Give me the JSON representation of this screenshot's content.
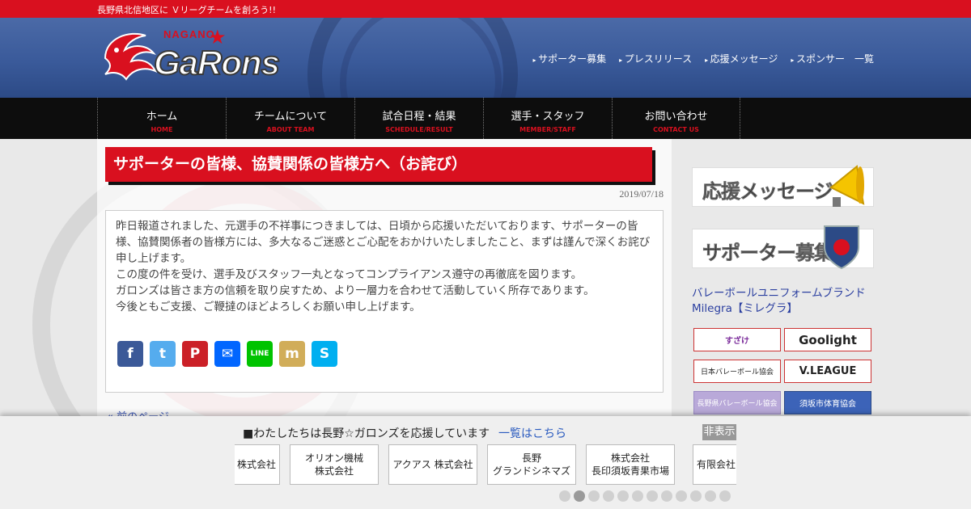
{
  "topbar": {
    "tagline": "長野県北信地区に Ｖリーグチームを創ろう!!"
  },
  "logo": {
    "nagano": "NAGANO",
    "star": "★",
    "name": "GaRons"
  },
  "topnav": [
    "サポーター募集",
    "プレスリリース",
    "応援メッセージ",
    "スポンサー　一覧"
  ],
  "mainnav": [
    {
      "jp": "ホーム",
      "en": "HOME"
    },
    {
      "jp": "チームについて",
      "en": "ABOUT TEAM"
    },
    {
      "jp": "試合日程・結果",
      "en": "SCHEDULE/RESULT"
    },
    {
      "jp": "選手・スタッフ",
      "en": "MEMBER/STAFF"
    },
    {
      "jp": "お問い合わせ",
      "en": "CONTACT US"
    }
  ],
  "article": {
    "title": "サポーターの皆様、協賛関係の皆様方へ（お詫び）",
    "date": "2019/07/18",
    "body": [
      "昨日報道されました、元選手の不祥事につきましては、日頃から応援いただいております、サポーターの皆様、協賛関係者の皆様方には、多大なるご迷惑とご心配をおかけいたしましたこと、まずは謹んで深くお詫び申し上げます。",
      "この度の件を受け、選手及びスタッフ一丸となってコンプライアンス遵守の再徹底を図ります。",
      "ガロンズは皆さま方の信頼を取り戻すため、より一層力を合わせて活動していく所存であります。",
      "今後ともご支援、ご鞭撻のほどよろしくお願い申し上げます。"
    ],
    "share": [
      {
        "icon": "facebook-icon",
        "glyph": "f",
        "color": "#3b5998"
      },
      {
        "icon": "twitter-icon",
        "glyph": "t",
        "color": "#55acee"
      },
      {
        "icon": "pinterest-icon",
        "glyph": "P",
        "color": "#cb2027"
      },
      {
        "icon": "email-icon",
        "glyph": "✉",
        "color": "#0166ff"
      },
      {
        "icon": "line-icon",
        "glyph": "LINE",
        "color": "#00c300"
      },
      {
        "icon": "mixi-icon",
        "glyph": "m",
        "color": "#d1ad59"
      },
      {
        "icon": "skype-icon",
        "glyph": "S",
        "color": "#00aff0"
      }
    ],
    "prev_link": "« 前のページ"
  },
  "sidebar": {
    "cheer_banner": "応援メッセージ",
    "supporter_banner": "サポーター募集",
    "uniform_alt": "バレーボールユニフォームブランド　Milegra【ミレグラ】",
    "sponsors": [
      "すざけ",
      "Goolight",
      "日本バレーボール協会",
      "V.LEAGUE",
      "長野県バレーボール協会",
      "須坂市体育協会"
    ]
  },
  "footer": {
    "message": "■わたしたちは長野☆ガロンズを応援しています",
    "link": "一覧はこちら",
    "hide": "非表示",
    "supporters": [
      "株式会社",
      "オリオン機械\n株式会社",
      "アクアス 株式会社",
      "長野\nグランドシネマズ",
      "株式会社\n長印須坂青果市場",
      "有限会社"
    ],
    "dots_total": 12,
    "dots_active_index": 1
  }
}
